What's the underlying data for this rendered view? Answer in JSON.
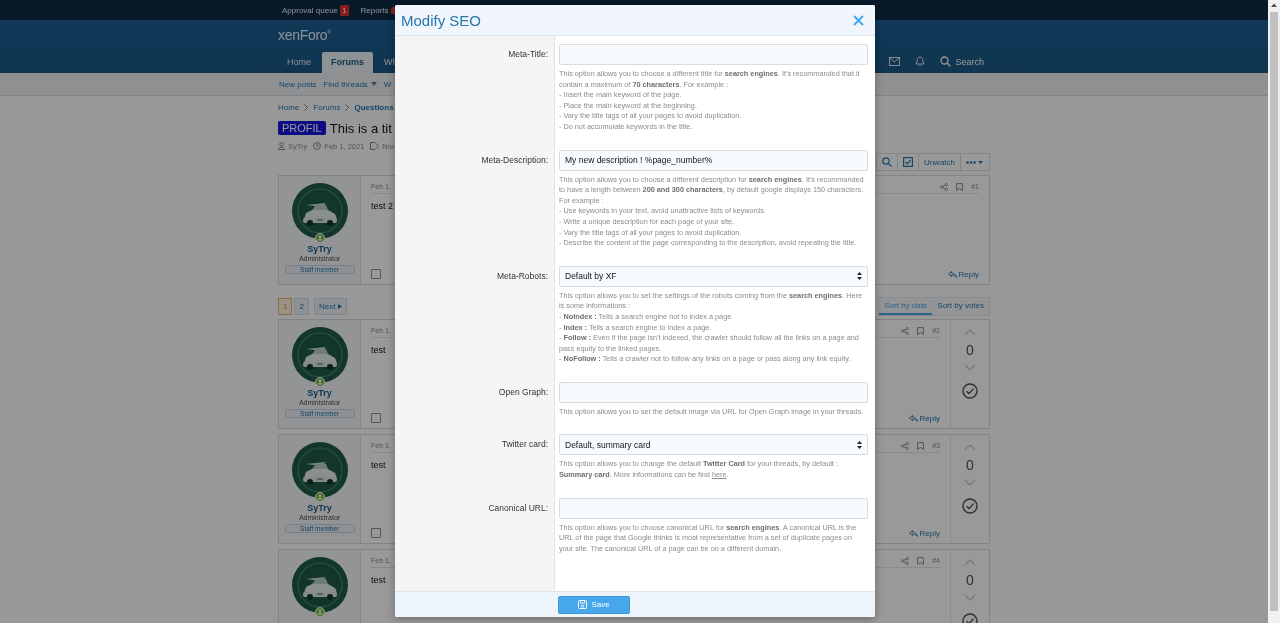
{
  "topbar": [
    {
      "label": "Approval queue",
      "count": "1"
    },
    {
      "label": "Reports",
      "alert": true
    }
  ],
  "logo": {
    "name": "xenForo",
    "mark": "®"
  },
  "nav": [
    {
      "label": "Home",
      "selected": false
    },
    {
      "label": "Forums",
      "selected": true
    },
    {
      "label": "Wh",
      "selected": false
    }
  ],
  "nav_search": "Search",
  "subnav": [
    {
      "label": "New posts",
      "dropdown": false
    },
    {
      "label": "Find threads",
      "dropdown": true
    },
    {
      "label": "W",
      "dropdown": false
    }
  ],
  "breadcrumb": [
    {
      "label": "Home",
      "current": false
    },
    {
      "label": "Forums",
      "current": false
    },
    {
      "label": "Questions",
      "current": true
    }
  ],
  "thread": {
    "prefix": "PROFIL",
    "title": "This is a tit",
    "author": "SyTry",
    "date": "Feb 1, 2021",
    "tag": "Nor",
    "watch": "Unwatch"
  },
  "pagination": {
    "pages": [
      {
        "label": "1",
        "selected": true
      },
      {
        "label": "2",
        "selected": false
      }
    ],
    "next": "Next"
  },
  "sort_tabs": [
    {
      "label": "Sort by date",
      "selected": true
    },
    {
      "label": "Sort by votes",
      "selected": false
    }
  ],
  "posts": [
    {
      "author": "SyTry",
      "role": "Administrator",
      "badge": "Staff member",
      "date": "Feb 1,",
      "text": "test 2",
      "number": "#1",
      "reply": "Reply",
      "selected": false
    },
    {
      "author": "SyTry",
      "role": "Administrator",
      "badge": "Staff member",
      "date": "Feb 1,",
      "text": "test",
      "number": "#2",
      "reply": "Reply",
      "votes": "0",
      "selected": false
    },
    {
      "author": "SyTry",
      "role": "Administrator",
      "badge": "Staff member",
      "date": "Feb 1,",
      "text": "test",
      "number": "#3",
      "reply": "Reply",
      "votes": "0",
      "selected": false
    },
    {
      "date": "Feb 1,",
      "text": "test",
      "number": "#4",
      "votes": "0"
    }
  ],
  "modal": {
    "title": "Modify SEO",
    "save": "Save",
    "fields": [
      {
        "label": "Meta-Title:",
        "kind": "input",
        "help": [
          "This option allows you to choose a different title for **search engines**. It's recommanded that it contain a maximum of **70 characters**. For example :",
          "- Insert the main keyword of the page.",
          "- Place the main keyword at the beginning.",
          "- Vary the title tags of all your pages to avoid duplication.",
          "- Do not accumulate keywords in the title."
        ]
      },
      {
        "label": "Meta-Description:",
        "kind": "input",
        "value": "My new description ! %page_number%",
        "help": [
          "This option allows you to choose a different description for **search engines**. It's recommanded to have a length between **200 and 300 characters**, by default google displays 150 characters. For example :",
          "- Use keywords in your text, avoid unattractive lists of keywords.",
          "- Write a unique description for each page of your site.",
          "- Vary the title tags of all your pages to avoid duplication.",
          "- Describe the content of the page corresponding to the description, avoid repeating the title."
        ]
      },
      {
        "label": "Meta-Robots:",
        "kind": "select",
        "value": "Default by XF",
        "help": [
          "This option allows you to set the settings of the robots coming from the **search engines**. Here is some informations :",
          "- **NoIndex :** Tells a search engine not to index a page.",
          "- **Index :** Tells a search engine to index a page.",
          "- **Follow :** Even if the page isn't indexed, the crawler should follow all the links on a page and pass equity to the linked pages.",
          "- **NoFollow :** Tells a crawler not to follow any links on a page or pass along any link equity."
        ]
      },
      {
        "label": "Open Graph:",
        "kind": "input",
        "help": [
          "This option allows you to set the default image via URL for Open Graph image in your threads."
        ]
      },
      {
        "label": "Twitter card:",
        "kind": "select",
        "value": "Default, summary card",
        "help": [
          "This option allows you to change the default **Twitter Card** for your threads, by default : **Summary card**. More informations can be find "
        ],
        "link": {
          "text": "here",
          "suffix": "."
        }
      },
      {
        "label": "Canonical URL:",
        "kind": "input",
        "help": [
          "This option allows you to choose canonical URL for **search engines**. A canonical URL is the URL of the page that Google thinks is most representative from a set of duplicate pages on your site. The canonical URL of a page can be on a different domain."
        ]
      }
    ]
  }
}
